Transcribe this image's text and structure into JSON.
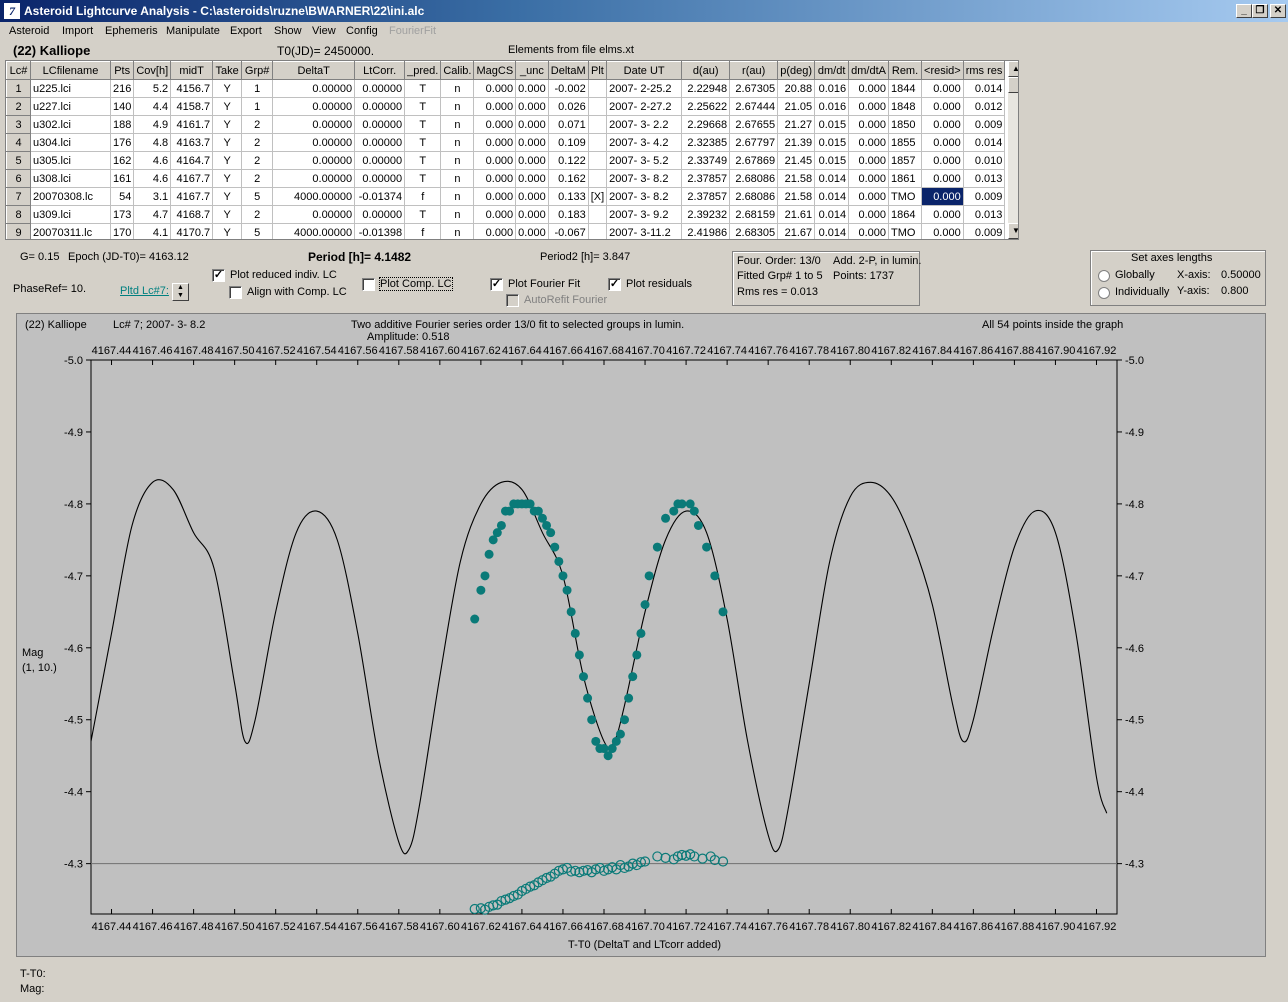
{
  "window": {
    "title": "Asteroid Lightcurve Analysis - C:\\asteroids\\ruzne\\BWARNER\\22\\ini.alc",
    "icon_label": "7",
    "buttons": [
      "_",
      "❐",
      "✕"
    ]
  },
  "menu": [
    {
      "label": "Asteroid",
      "enabled": true
    },
    {
      "label": "Import",
      "enabled": true
    },
    {
      "label": "Ephemeris",
      "enabled": true
    },
    {
      "label": "Manipulate",
      "enabled": true
    },
    {
      "label": "Export",
      "enabled": true
    },
    {
      "label": "Show",
      "enabled": true
    },
    {
      "label": "View",
      "enabled": true
    },
    {
      "label": "Config",
      "enabled": true
    },
    {
      "label": "FourierFit",
      "enabled": false
    }
  ],
  "header": {
    "asteroid": "(22) Kalliope",
    "t0": "T0(JD)= 2450000.",
    "elements": "Elements from file elms.xt"
  },
  "table": {
    "columns": [
      "Lc#",
      "LCfilename",
      "Pts",
      "Cov[h]",
      "midT",
      "Take",
      "Grp#",
      "DeltaT",
      "LtCorr.",
      "_pred.",
      "Calib.",
      "MagCS",
      "_unc",
      "DeltaM",
      "Plt",
      "Date UT",
      "d(au)",
      "r(au)",
      "p(deg)",
      "dm/dt",
      "dm/dtA",
      "Rem.",
      "<resid>",
      "rms res"
    ],
    "rows": [
      [
        "1",
        "u225.lci",
        "216",
        "5.2",
        "4156.7",
        "Y",
        "1",
        "0.00000",
        "0.00000",
        "T",
        "n",
        "0.000",
        "0.000",
        "-0.002",
        "",
        "2007- 2-25.2",
        "2.22948",
        "2.67305",
        "20.88",
        "0.016",
        "0.000",
        "1844",
        "0.000",
        "0.014"
      ],
      [
        "2",
        "u227.lci",
        "140",
        "4.4",
        "4158.7",
        "Y",
        "1",
        "0.00000",
        "0.00000",
        "T",
        "n",
        "0.000",
        "0.000",
        "0.026",
        "",
        "2007- 2-27.2",
        "2.25622",
        "2.67444",
        "21.05",
        "0.016",
        "0.000",
        "1848",
        "0.000",
        "0.012"
      ],
      [
        "3",
        "u302.lci",
        "188",
        "4.9",
        "4161.7",
        "Y",
        "2",
        "0.00000",
        "0.00000",
        "T",
        "n",
        "0.000",
        "0.000",
        "0.071",
        "",
        "2007- 3- 2.2",
        "2.29668",
        "2.67655",
        "21.27",
        "0.015",
        "0.000",
        "1850",
        "0.000",
        "0.009"
      ],
      [
        "4",
        "u304.lci",
        "176",
        "4.8",
        "4163.7",
        "Y",
        "2",
        "0.00000",
        "0.00000",
        "T",
        "n",
        "0.000",
        "0.000",
        "0.109",
        "",
        "2007- 3- 4.2",
        "2.32385",
        "2.67797",
        "21.39",
        "0.015",
        "0.000",
        "1855",
        "0.000",
        "0.014"
      ],
      [
        "5",
        "u305.lci",
        "162",
        "4.6",
        "4164.7",
        "Y",
        "2",
        "0.00000",
        "0.00000",
        "T",
        "n",
        "0.000",
        "0.000",
        "0.122",
        "",
        "2007- 3- 5.2",
        "2.33749",
        "2.67869",
        "21.45",
        "0.015",
        "0.000",
        "1857",
        "0.000",
        "0.010"
      ],
      [
        "6",
        "u308.lci",
        "161",
        "4.6",
        "4167.7",
        "Y",
        "2",
        "0.00000",
        "0.00000",
        "T",
        "n",
        "0.000",
        "0.000",
        "0.162",
        "",
        "2007- 3- 8.2",
        "2.37857",
        "2.68086",
        "21.58",
        "0.014",
        "0.000",
        "1861",
        "0.000",
        "0.013"
      ],
      [
        "7",
        "20070308.lc",
        "54",
        "3.1",
        "4167.7",
        "Y",
        "5",
        "4000.00000",
        "-0.01374",
        "f",
        "n",
        "0.000",
        "0.000",
        "0.133",
        "[X]",
        "2007- 3- 8.2",
        "2.37857",
        "2.68086",
        "21.58",
        "0.014",
        "0.000",
        "TMO",
        "0.000",
        "0.009"
      ],
      [
        "8",
        "u309.lci",
        "173",
        "4.7",
        "4168.7",
        "Y",
        "2",
        "0.00000",
        "0.00000",
        "T",
        "n",
        "0.000",
        "0.000",
        "0.183",
        "",
        "2007- 3- 9.2",
        "2.39232",
        "2.68159",
        "21.61",
        "0.014",
        "0.000",
        "1864",
        "0.000",
        "0.013"
      ],
      [
        "9",
        "20070311.lc",
        "170",
        "4.1",
        "4170.7",
        "Y",
        "5",
        "4000.00000",
        "-0.01398",
        "f",
        "n",
        "0.000",
        "0.000",
        "-0.067",
        "",
        "2007- 3-11.2",
        "2.41986",
        "2.68305",
        "21.67",
        "0.014",
        "0.000",
        "TMO",
        "0.000",
        "0.009"
      ]
    ],
    "selected": {
      "row": 6,
      "col": 22
    }
  },
  "params": {
    "g": "G= 0.15",
    "epoch": "Epoch (JD-T0)= 4163.12",
    "period_label": "Period [h]= ",
    "period_value": "4.1482",
    "period2": "Period2 [h]= 3.847",
    "phaseref": "PhaseRef= 10.",
    "pltd_lc": "Pltd Lc#7:"
  },
  "checks": {
    "plot_reduced": {
      "label": "Plot reduced indiv. LC",
      "checked": true
    },
    "align_comp": {
      "label": "Align with Comp. LC",
      "checked": false
    },
    "plot_comp": {
      "label": "Plot Comp. LC",
      "checked": false
    },
    "plot_fourier": {
      "label": "Plot Fourier Fit",
      "checked": true
    },
    "plot_residuals": {
      "label": "Plot residuals",
      "checked": true
    },
    "autorefit": {
      "label": "AutoRefit Fourier",
      "checked": false
    }
  },
  "fitinfo": {
    "order": "Four. Order: 13/0",
    "add": "Add. 2-P, in lumin.",
    "fitted": "Fitted Grp# 1 to 5",
    "points": "Points: 1737",
    "rms": "Rms res    = 0.013"
  },
  "axes_box": {
    "title": "Set axes lengths",
    "globally": "Globally",
    "individually": "Individually",
    "xaxis_label": "X-axis:",
    "xaxis_value": "0.50000",
    "yaxis_label": "Y-axis:",
    "yaxis_value": "0.800"
  },
  "plot_text": {
    "object": "(22) Kalliope",
    "lc": "Lc# 7; 2007- 3- 8.2",
    "caption": "Two additive Fourier series order 13/0 fit to selected groups in lumin.",
    "amplitude": "Amplitude: 0.518",
    "points_inside": "All 54 points inside the graph",
    "ylabel1": "Mag",
    "ylabel2": "(1, 10.)",
    "xlabel": "T-T0 (DeltaT and LTcorr added)"
  },
  "status": {
    "tt0": "T-T0:",
    "mag": "Mag:"
  },
  "chart_data": {
    "type": "scatter",
    "xlim": [
      4167.43,
      4167.93
    ],
    "ylim": [
      -5.0,
      -4.23
    ],
    "x_ticks": [
      4167.44,
      4167.46,
      4167.48,
      4167.5,
      4167.52,
      4167.54,
      4167.56,
      4167.58,
      4167.6,
      4167.62,
      4167.64,
      4167.66,
      4167.68,
      4167.7,
      4167.72,
      4167.74,
      4167.76,
      4167.78,
      4167.8,
      4167.82,
      4167.84,
      4167.86,
      4167.88,
      4167.9,
      4167.92
    ],
    "y_ticks": [
      -5.0,
      -4.9,
      -4.8,
      -4.7,
      -4.6,
      -4.5,
      -4.4,
      -4.3
    ],
    "reference_line_y": -4.3,
    "fit_curve": [
      [
        4167.43,
        -4.47
      ],
      [
        4167.44,
        -4.62
      ],
      [
        4167.45,
        -4.77
      ],
      [
        4167.46,
        -4.83
      ],
      [
        4167.47,
        -4.82
      ],
      [
        4167.48,
        -4.76
      ],
      [
        4167.49,
        -4.71
      ],
      [
        4167.5,
        -4.55
      ],
      [
        4167.505,
        -4.47
      ],
      [
        4167.51,
        -4.5
      ],
      [
        4167.52,
        -4.65
      ],
      [
        4167.53,
        -4.76
      ],
      [
        4167.54,
        -4.79
      ],
      [
        4167.55,
        -4.75
      ],
      [
        4167.56,
        -4.62
      ],
      [
        4167.57,
        -4.45
      ],
      [
        4167.58,
        -4.33
      ],
      [
        4167.585,
        -4.32
      ],
      [
        4167.59,
        -4.38
      ],
      [
        4167.6,
        -4.56
      ],
      [
        4167.61,
        -4.72
      ],
      [
        4167.62,
        -4.8
      ],
      [
        4167.63,
        -4.83
      ],
      [
        4167.64,
        -4.82
      ],
      [
        4167.65,
        -4.76
      ],
      [
        4167.66,
        -4.7
      ],
      [
        4167.67,
        -4.56
      ],
      [
        4167.68,
        -4.47
      ],
      [
        4167.685,
        -4.47
      ],
      [
        4167.69,
        -4.52
      ],
      [
        4167.7,
        -4.65
      ],
      [
        4167.71,
        -4.75
      ],
      [
        4167.72,
        -4.79
      ],
      [
        4167.73,
        -4.76
      ],
      [
        4167.74,
        -4.64
      ],
      [
        4167.75,
        -4.47
      ],
      [
        4167.76,
        -4.34
      ],
      [
        4167.765,
        -4.32
      ],
      [
        4167.77,
        -4.38
      ],
      [
        4167.78,
        -4.55
      ],
      [
        4167.79,
        -4.72
      ],
      [
        4167.8,
        -4.81
      ],
      [
        4167.81,
        -4.83
      ],
      [
        4167.82,
        -4.81
      ],
      [
        4167.83,
        -4.75
      ],
      [
        4167.84,
        -4.66
      ],
      [
        4167.85,
        -4.52
      ],
      [
        4167.855,
        -4.47
      ],
      [
        4167.86,
        -4.5
      ],
      [
        4167.87,
        -4.63
      ],
      [
        4167.88,
        -4.74
      ],
      [
        4167.89,
        -4.79
      ],
      [
        4167.9,
        -4.76
      ],
      [
        4167.91,
        -4.62
      ],
      [
        4167.92,
        -4.42
      ],
      [
        4167.925,
        -4.37
      ]
    ],
    "observations": [
      [
        4167.617,
        -4.64
      ],
      [
        4167.62,
        -4.68
      ],
      [
        4167.622,
        -4.7
      ],
      [
        4167.624,
        -4.73
      ],
      [
        4167.626,
        -4.75
      ],
      [
        4167.628,
        -4.76
      ],
      [
        4167.63,
        -4.77
      ],
      [
        4167.632,
        -4.79
      ],
      [
        4167.634,
        -4.79
      ],
      [
        4167.636,
        -4.8
      ],
      [
        4167.638,
        -4.8
      ],
      [
        4167.64,
        -4.8
      ],
      [
        4167.642,
        -4.8
      ],
      [
        4167.644,
        -4.8
      ],
      [
        4167.646,
        -4.79
      ],
      [
        4167.648,
        -4.79
      ],
      [
        4167.65,
        -4.78
      ],
      [
        4167.652,
        -4.77
      ],
      [
        4167.654,
        -4.76
      ],
      [
        4167.656,
        -4.74
      ],
      [
        4167.658,
        -4.72
      ],
      [
        4167.66,
        -4.7
      ],
      [
        4167.662,
        -4.68
      ],
      [
        4167.664,
        -4.65
      ],
      [
        4167.666,
        -4.62
      ],
      [
        4167.668,
        -4.59
      ],
      [
        4167.67,
        -4.56
      ],
      [
        4167.672,
        -4.53
      ],
      [
        4167.674,
        -4.5
      ],
      [
        4167.676,
        -4.47
      ],
      [
        4167.678,
        -4.46
      ],
      [
        4167.68,
        -4.46
      ],
      [
        4167.682,
        -4.45
      ],
      [
        4167.684,
        -4.46
      ],
      [
        4167.686,
        -4.47
      ],
      [
        4167.688,
        -4.48
      ],
      [
        4167.69,
        -4.5
      ],
      [
        4167.692,
        -4.53
      ],
      [
        4167.694,
        -4.56
      ],
      [
        4167.696,
        -4.59
      ],
      [
        4167.698,
        -4.62
      ],
      [
        4167.7,
        -4.66
      ],
      [
        4167.702,
        -4.7
      ],
      [
        4167.706,
        -4.74
      ],
      [
        4167.71,
        -4.78
      ],
      [
        4167.714,
        -4.79
      ],
      [
        4167.716,
        -4.8
      ],
      [
        4167.718,
        -4.8
      ],
      [
        4167.722,
        -4.8
      ],
      [
        4167.724,
        -4.79
      ],
      [
        4167.726,
        -4.77
      ],
      [
        4167.73,
        -4.74
      ],
      [
        4167.734,
        -4.7
      ],
      [
        4167.738,
        -4.65
      ]
    ],
    "residuals": [
      [
        4167.617,
        -4.237
      ],
      [
        4167.62,
        -4.238
      ],
      [
        4167.622,
        -4.236
      ],
      [
        4167.624,
        -4.24
      ],
      [
        4167.626,
        -4.242
      ],
      [
        4167.628,
        -4.243
      ],
      [
        4167.63,
        -4.248
      ],
      [
        4167.632,
        -4.25
      ],
      [
        4167.634,
        -4.252
      ],
      [
        4167.636,
        -4.255
      ],
      [
        4167.638,
        -4.257
      ],
      [
        4167.64,
        -4.262
      ],
      [
        4167.642,
        -4.265
      ],
      [
        4167.644,
        -4.268
      ],
      [
        4167.646,
        -4.27
      ],
      [
        4167.648,
        -4.274
      ],
      [
        4167.65,
        -4.277
      ],
      [
        4167.652,
        -4.28
      ],
      [
        4167.654,
        -4.282
      ],
      [
        4167.656,
        -4.286
      ],
      [
        4167.658,
        -4.29
      ],
      [
        4167.66,
        -4.292
      ],
      [
        4167.662,
        -4.294
      ],
      [
        4167.664,
        -4.289
      ],
      [
        4167.666,
        -4.29
      ],
      [
        4167.668,
        -4.288
      ],
      [
        4167.67,
        -4.29
      ],
      [
        4167.672,
        -4.291
      ],
      [
        4167.674,
        -4.288
      ],
      [
        4167.676,
        -4.292
      ],
      [
        4167.678,
        -4.294
      ],
      [
        4167.68,
        -4.29
      ],
      [
        4167.682,
        -4.292
      ],
      [
        4167.684,
        -4.295
      ],
      [
        4167.686,
        -4.292
      ],
      [
        4167.688,
        -4.298
      ],
      [
        4167.69,
        -4.294
      ],
      [
        4167.692,
        -4.296
      ],
      [
        4167.694,
        -4.3
      ],
      [
        4167.696,
        -4.298
      ],
      [
        4167.698,
        -4.302
      ],
      [
        4167.7,
        -4.303
      ],
      [
        4167.706,
        -4.31
      ],
      [
        4167.71,
        -4.308
      ],
      [
        4167.714,
        -4.306
      ],
      [
        4167.716,
        -4.31
      ],
      [
        4167.718,
        -4.312
      ],
      [
        4167.72,
        -4.311
      ],
      [
        4167.722,
        -4.313
      ],
      [
        4167.724,
        -4.31
      ],
      [
        4167.728,
        -4.307
      ],
      [
        4167.732,
        -4.31
      ],
      [
        4167.734,
        -4.305
      ],
      [
        4167.738,
        -4.303
      ]
    ],
    "colors": {
      "points": "#0a7a78",
      "curve": "#000000",
      "background": "#c0c0c0"
    }
  }
}
